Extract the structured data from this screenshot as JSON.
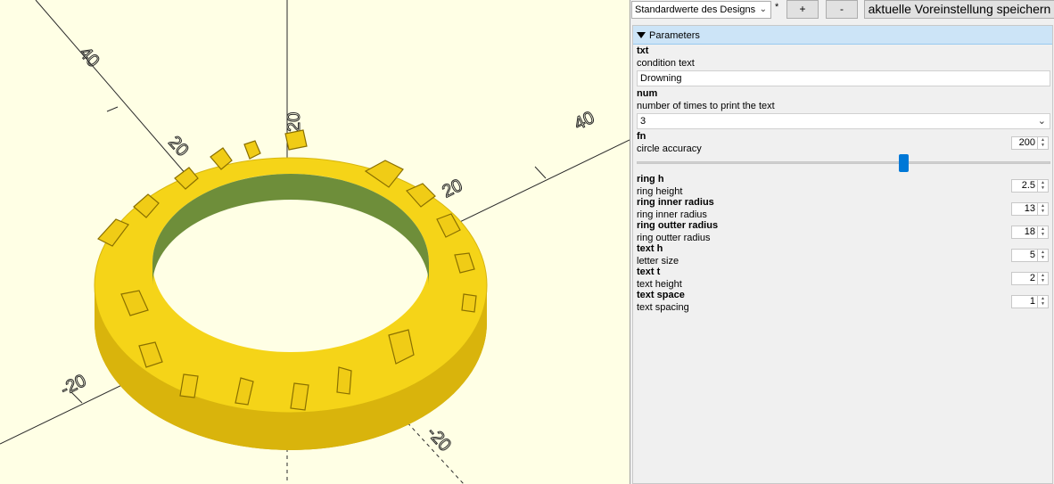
{
  "toolbar": {
    "preset": "Standardwerte des Designs",
    "dirty_marker": "*",
    "add_label": "+",
    "remove_label": "-",
    "save_label": "aktuelle Voreinstellung speichern"
  },
  "viewport": {
    "axis_labels": [
      "40",
      "20",
      "40",
      "20",
      "20",
      "-20",
      "-20"
    ],
    "model_text": "Drowning Drowning Drowning"
  },
  "parameters": {
    "header": "Parameters",
    "txt": {
      "name": "txt",
      "desc": "condition text",
      "value": "Drowning"
    },
    "num": {
      "name": "num",
      "desc": "number of times to print the text",
      "value": "3"
    },
    "fn": {
      "name": "fn",
      "desc": "circle accuracy",
      "value": "200",
      "slider_fraction": 0.65
    },
    "ring_h": {
      "name": "ring h",
      "desc": "ring height",
      "value": "2.5"
    },
    "ring_inner_radius": {
      "name": "ring inner radius",
      "desc": "ring inner radius",
      "value": "13"
    },
    "ring_outter_radius": {
      "name": "ring outter radius",
      "desc": "ring outter radius",
      "value": "18"
    },
    "text_h": {
      "name": "text h",
      "desc": "letter size",
      "value": "5"
    },
    "text_t": {
      "name": "text t",
      "desc": "text height",
      "value": "2"
    },
    "text_space": {
      "name": "text space",
      "desc": "text spacing",
      "value": "1"
    }
  },
  "colors": {
    "viewport_bg": "#ffffe5",
    "model": "#f5d418",
    "model_inner": "#6e8e3a",
    "header_bg": "#cce4f7",
    "slider_thumb": "#0078d7"
  }
}
